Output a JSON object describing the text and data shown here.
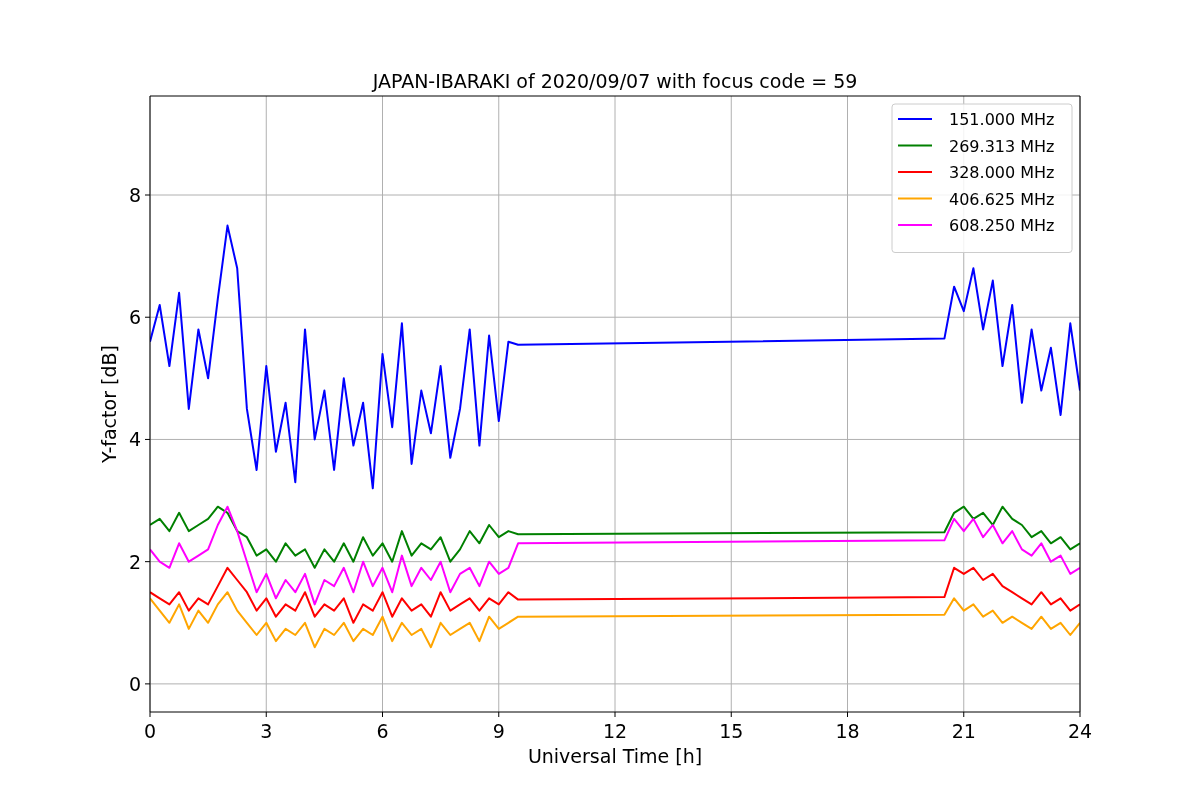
{
  "chart_data": {
    "type": "line",
    "title": "JAPAN-IBARAKI of 2020/09/07 with focus code = 59",
    "xlabel": "Universal Time [h]",
    "ylabel": "Y-factor [dB]",
    "x": [
      0,
      0.25,
      0.5,
      0.75,
      1,
      1.25,
      1.5,
      1.75,
      2,
      2.25,
      2.5,
      2.75,
      3,
      3.25,
      3.5,
      3.75,
      4,
      4.25,
      4.5,
      4.75,
      5,
      5.25,
      5.5,
      5.75,
      6,
      6.25,
      6.5,
      6.75,
      7,
      7.25,
      7.5,
      7.75,
      8,
      8.25,
      8.5,
      8.75,
      9,
      9.25,
      9.5,
      20.5,
      20.75,
      21,
      21.25,
      21.5,
      21.75,
      22,
      22.25,
      22.5,
      22.75,
      23,
      23.25,
      23.5,
      23.75,
      24
    ],
    "series": [
      {
        "name": "151.000 MHz",
        "color": "#0000ff",
        "values": [
          5.6,
          6.2,
          5.2,
          6.4,
          4.5,
          5.8,
          5.0,
          6.3,
          7.5,
          6.8,
          4.5,
          3.5,
          5.2,
          3.8,
          4.6,
          3.3,
          5.8,
          4.0,
          4.8,
          3.5,
          5.0,
          3.9,
          4.6,
          3.2,
          5.4,
          4.2,
          5.9,
          3.6,
          4.8,
          4.1,
          5.2,
          3.7,
          4.5,
          5.8,
          3.9,
          5.7,
          4.3,
          5.6,
          5.55,
          5.65,
          6.5,
          6.1,
          6.8,
          5.8,
          6.6,
          5.2,
          6.2,
          4.6,
          5.8,
          4.8,
          5.5,
          4.4,
          5.9,
          4.8
        ]
      },
      {
        "name": "269.313 MHz",
        "color": "#008000",
        "values": [
          2.6,
          2.7,
          2.5,
          2.8,
          2.5,
          2.6,
          2.7,
          2.9,
          2.8,
          2.5,
          2.4,
          2.1,
          2.2,
          2.0,
          2.3,
          2.1,
          2.2,
          1.9,
          2.2,
          2.0,
          2.3,
          2.0,
          2.4,
          2.1,
          2.3,
          2.0,
          2.5,
          2.1,
          2.3,
          2.2,
          2.4,
          2.0,
          2.2,
          2.5,
          2.3,
          2.6,
          2.4,
          2.5,
          2.45,
          2.48,
          2.8,
          2.9,
          2.7,
          2.8,
          2.6,
          2.9,
          2.7,
          2.6,
          2.4,
          2.5,
          2.3,
          2.4,
          2.2,
          2.3
        ]
      },
      {
        "name": "328.000 MHz",
        "color": "#ff0000",
        "values": [
          1.5,
          1.4,
          1.3,
          1.5,
          1.2,
          1.4,
          1.3,
          1.6,
          1.9,
          1.7,
          1.5,
          1.2,
          1.4,
          1.1,
          1.3,
          1.2,
          1.5,
          1.1,
          1.3,
          1.2,
          1.4,
          1.0,
          1.3,
          1.2,
          1.5,
          1.1,
          1.4,
          1.2,
          1.3,
          1.1,
          1.5,
          1.2,
          1.3,
          1.4,
          1.2,
          1.4,
          1.3,
          1.5,
          1.38,
          1.42,
          1.9,
          1.8,
          1.9,
          1.7,
          1.8,
          1.6,
          1.5,
          1.4,
          1.3,
          1.5,
          1.3,
          1.4,
          1.2,
          1.3
        ]
      },
      {
        "name": "406.625 MHz",
        "color": "#ffa500",
        "values": [
          1.4,
          1.2,
          1.0,
          1.3,
          0.9,
          1.2,
          1.0,
          1.3,
          1.5,
          1.2,
          1.0,
          0.8,
          1.0,
          0.7,
          0.9,
          0.8,
          1.0,
          0.6,
          0.9,
          0.8,
          1.0,
          0.7,
          0.9,
          0.8,
          1.1,
          0.7,
          1.0,
          0.8,
          0.9,
          0.6,
          1.0,
          0.8,
          0.9,
          1.0,
          0.7,
          1.1,
          0.9,
          1.0,
          1.1,
          1.13,
          1.4,
          1.2,
          1.3,
          1.1,
          1.2,
          1.0,
          1.1,
          1.0,
          0.9,
          1.1,
          0.9,
          1.0,
          0.8,
          1.0
        ]
      },
      {
        "name": "608.250 MHz",
        "color": "#ff00ff",
        "values": [
          2.2,
          2.0,
          1.9,
          2.3,
          2.0,
          2.1,
          2.2,
          2.6,
          2.9,
          2.5,
          2.0,
          1.5,
          1.8,
          1.4,
          1.7,
          1.5,
          1.8,
          1.3,
          1.7,
          1.6,
          1.9,
          1.5,
          2.0,
          1.6,
          1.9,
          1.5,
          2.1,
          1.6,
          1.9,
          1.7,
          2.0,
          1.5,
          1.8,
          1.9,
          1.6,
          2.0,
          1.8,
          1.9,
          2.3,
          2.35,
          2.7,
          2.5,
          2.7,
          2.4,
          2.6,
          2.3,
          2.5,
          2.2,
          2.1,
          2.3,
          2.0,
          2.1,
          1.8,
          1.9
        ]
      }
    ],
    "xlim": [
      0,
      24
    ],
    "ylim": [
      -0.46,
      9.62
    ],
    "xticks": [
      0,
      3,
      6,
      9,
      12,
      15,
      18,
      21,
      24
    ],
    "yticks": [
      0,
      2,
      4,
      6,
      8
    ],
    "grid": true,
    "legend": true
  }
}
